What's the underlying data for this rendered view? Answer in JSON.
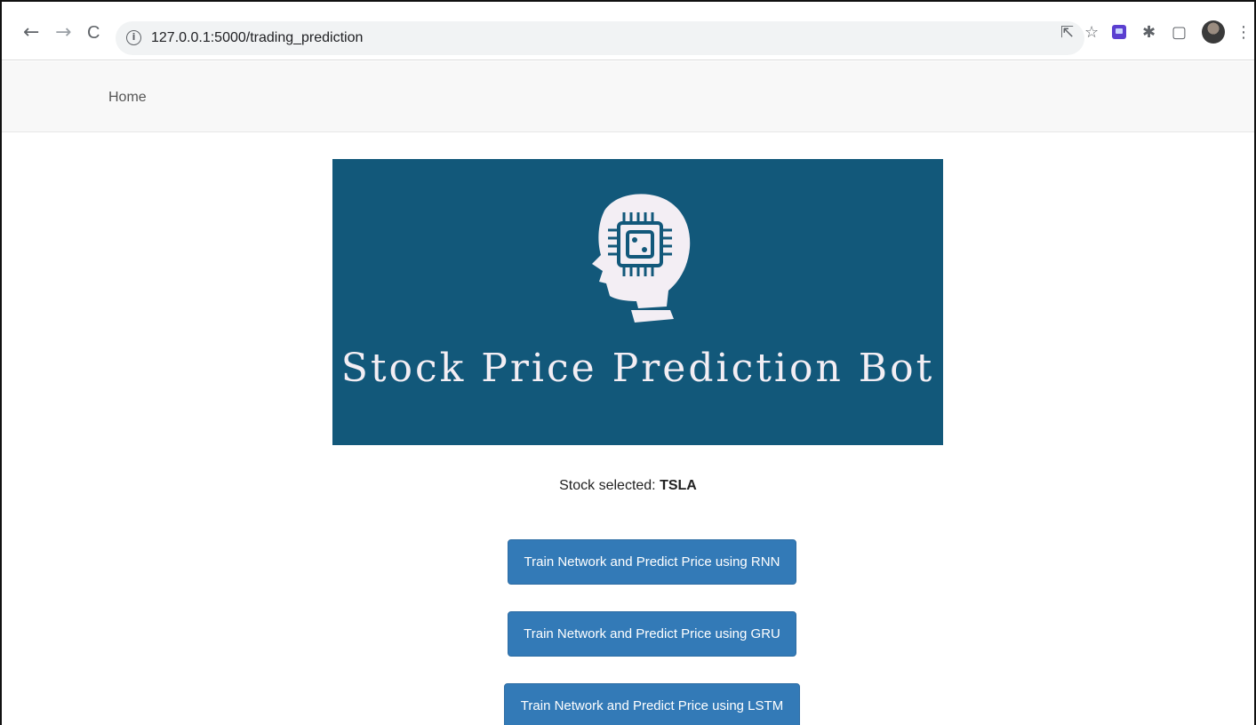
{
  "browser": {
    "back_glyph": "←",
    "forward_glyph": "→",
    "reload_glyph": "C",
    "info_glyph": "i",
    "url": "127.0.0.1:5000/trading_prediction",
    "icons": [
      "share-icon",
      "star-icon",
      "extension-icon",
      "puzzle-icon",
      "sidebar-icon",
      "avatar",
      "menu-icon"
    ],
    "share_glyph": "⇱",
    "star_glyph": "☆",
    "puzzle_glyph": "✱",
    "sidebar_glyph": "▢",
    "menu_glyph": "⋮"
  },
  "navbar": {
    "home_label": "Home"
  },
  "banner": {
    "title": "Stock Price Prediction Bot",
    "background_color": "#12587a",
    "icon": "head-with-chip-icon"
  },
  "stock": {
    "label": "Stock selected:",
    "symbol": "TSLA"
  },
  "buttons": {
    "rnn": "Train Network and Predict Price using RNN",
    "gru": "Train Network and Predict Price using GRU",
    "lstm": "Train Network and Predict Price using LSTM",
    "color": "#337ab7"
  }
}
